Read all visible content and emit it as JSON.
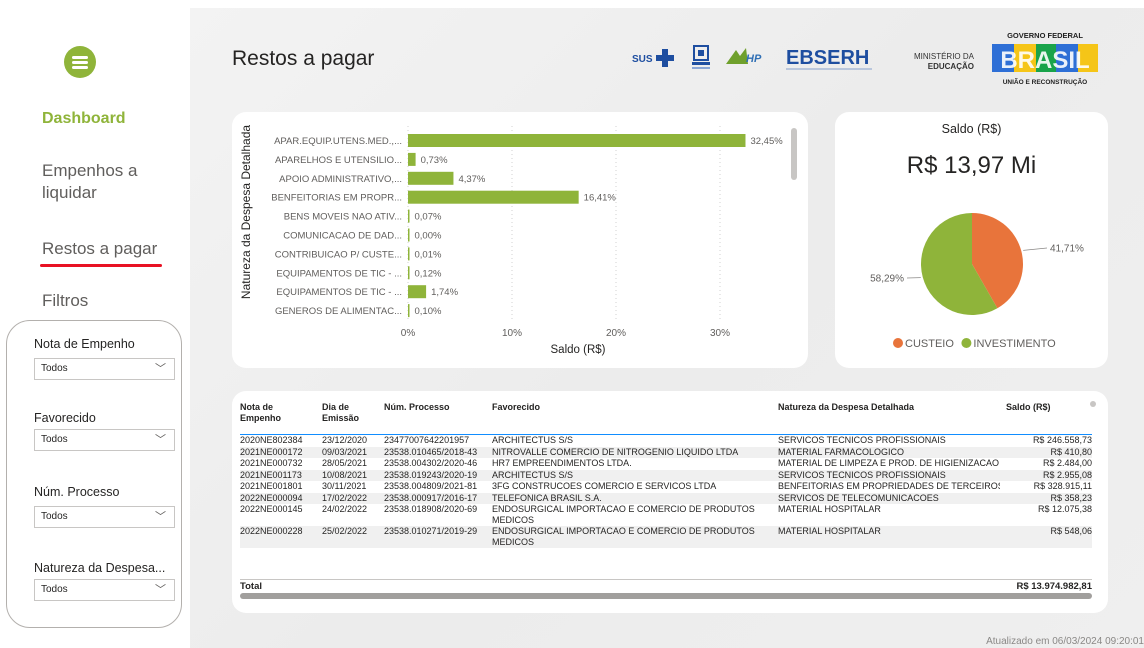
{
  "nav": {
    "items": [
      "Dashboard",
      "Empenhos a liquidar",
      "Restos a pagar",
      "Filtros"
    ]
  },
  "filters": [
    {
      "label": "Nota de Empenho",
      "value": "Todos"
    },
    {
      "label": "Favorecido",
      "value": "Todos"
    },
    {
      "label": "Núm. Processo",
      "value": "Todos"
    },
    {
      "label": "Natureza da Despesa...",
      "value": "Todos"
    }
  ],
  "header": {
    "title": "Restos a pagar",
    "logos": {
      "sus": "SUS",
      "ebserh": "EBSERH",
      "ministerio": [
        "MINISTÉRIO DA",
        "EDUCAÇÃO"
      ],
      "governo": "GOVERNO FEDERAL",
      "brasil": "BRASIL",
      "uniao": "UNIÃO E RECONSTRUÇÃO"
    }
  },
  "bar_chart": {
    "ylabel": "Natureza da Despesa Detalhada",
    "xlabel": "Saldo (R$)"
  },
  "saldo": {
    "title": "Saldo (R$)",
    "value": "R$ 13,97 Mi"
  },
  "chart_data": [
    {
      "type": "bar",
      "orientation": "horizontal",
      "categories": [
        "APAR.EQUIP.UTENS.MED.,...",
        "APARELHOS E UTENSILIO...",
        "APOIO ADMINISTRATIVO,...",
        "BENFEITORIAS EM PROPR...",
        "BENS MOVEIS NAO ATIV...",
        "COMUNICACAO DE DAD...",
        "CONTRIBUICAO P/ CUSTE...",
        "EQUIPAMENTOS DE TIC - ...",
        "EQUIPAMENTOS DE TIC - ...",
        "GENEROS DE ALIMENTAC..."
      ],
      "values": [
        32.45,
        0.73,
        4.37,
        16.41,
        0.07,
        0.0,
        0.01,
        0.12,
        1.74,
        0.1
      ],
      "data_labels": [
        "32,45%",
        "0,73%",
        "4,37%",
        "16,41%",
        "0,07%",
        "0,00%",
        "0,01%",
        "0,12%",
        "1,74%",
        "0,10%"
      ],
      "xticks": [
        "0%",
        "10%",
        "20%",
        "30%"
      ],
      "xlim": [
        0,
        35
      ],
      "xlabel": "Saldo (R$)",
      "ylabel": "Natureza da Despesa Detalhada",
      "color": "#8fb43a",
      "grid": true
    },
    {
      "type": "pie",
      "variant": "donut-full",
      "slices": [
        {
          "name": "CUSTEIO",
          "value": 41.71,
          "label": "41,71%",
          "color": "#e8743b"
        },
        {
          "name": "INVESTIMENTO",
          "value": 58.29,
          "label": "58,29%",
          "color": "#8fb43a"
        }
      ],
      "legend": "bottom"
    }
  ],
  "table": {
    "columns": [
      "Nota de Empenho",
      "Dia de Emissão",
      "Núm. Processo",
      "Favorecido",
      "Natureza da Despesa Detalhada",
      "Saldo (R$)"
    ],
    "rows": [
      [
        "2020NE802384",
        "23/12/2020",
        "23477007642201957",
        "ARCHITECTUS S/S",
        "SERVICOS TECNICOS PROFISSIONAIS",
        "R$ 246.558,73"
      ],
      [
        "2021NE000172",
        "09/03/2021",
        "23538.010465/2018-43",
        "NITROVALLE COMERCIO DE NITROGENIO LIQUIDO LTDA",
        "MATERIAL FARMACOLOGICO",
        "R$ 410,80"
      ],
      [
        "2021NE000732",
        "28/05/2021",
        "23538.004302/2020-46",
        "HR7 EMPREENDIMENTOS LTDA.",
        "MATERIAL DE LIMPEZA E PROD. DE HIGIENIZACAO",
        "R$ 2.484,00"
      ],
      [
        "2021NE001173",
        "10/08/2021",
        "23538.019243/2020-19",
        "ARCHITECTUS S/S",
        "SERVICOS TECNICOS PROFISSIONAIS",
        "R$ 2.955,08"
      ],
      [
        "2021NE001801",
        "30/11/2021",
        "23538.004809/2021-81",
        "3FG CONSTRUCOES COMERCIO E SERVICOS LTDA",
        "BENFEITORIAS EM PROPRIEDADES DE TERCEIROS",
        "R$ 328.915,11"
      ],
      [
        "2022NE000094",
        "17/02/2022",
        "23538.000917/2016-17",
        "TELEFONICA BRASIL S.A.",
        "SERVICOS DE TELECOMUNICACOES",
        "R$ 358,23"
      ],
      [
        "2022NE000145",
        "24/02/2022",
        "23538.018908/2020-69",
        "ENDOSURGICAL IMPORTACAO E COMERCIO DE PRODUTOS MEDICOS",
        "MATERIAL HOSPITALAR",
        "R$ 12.075,38"
      ],
      [
        "2022NE000228",
        "25/02/2022",
        "23538.010271/2019-29",
        "ENDOSURGICAL IMPORTACAO E COMERCIO DE PRODUTOS MEDICOS",
        "MATERIAL HOSPITALAR",
        "R$ 548,06"
      ]
    ],
    "total_label": "Total",
    "total_value": "R$ 13.974.982,81"
  },
  "footer": {
    "updated": "Atualizado em 06/03/2024 09:20:01"
  }
}
